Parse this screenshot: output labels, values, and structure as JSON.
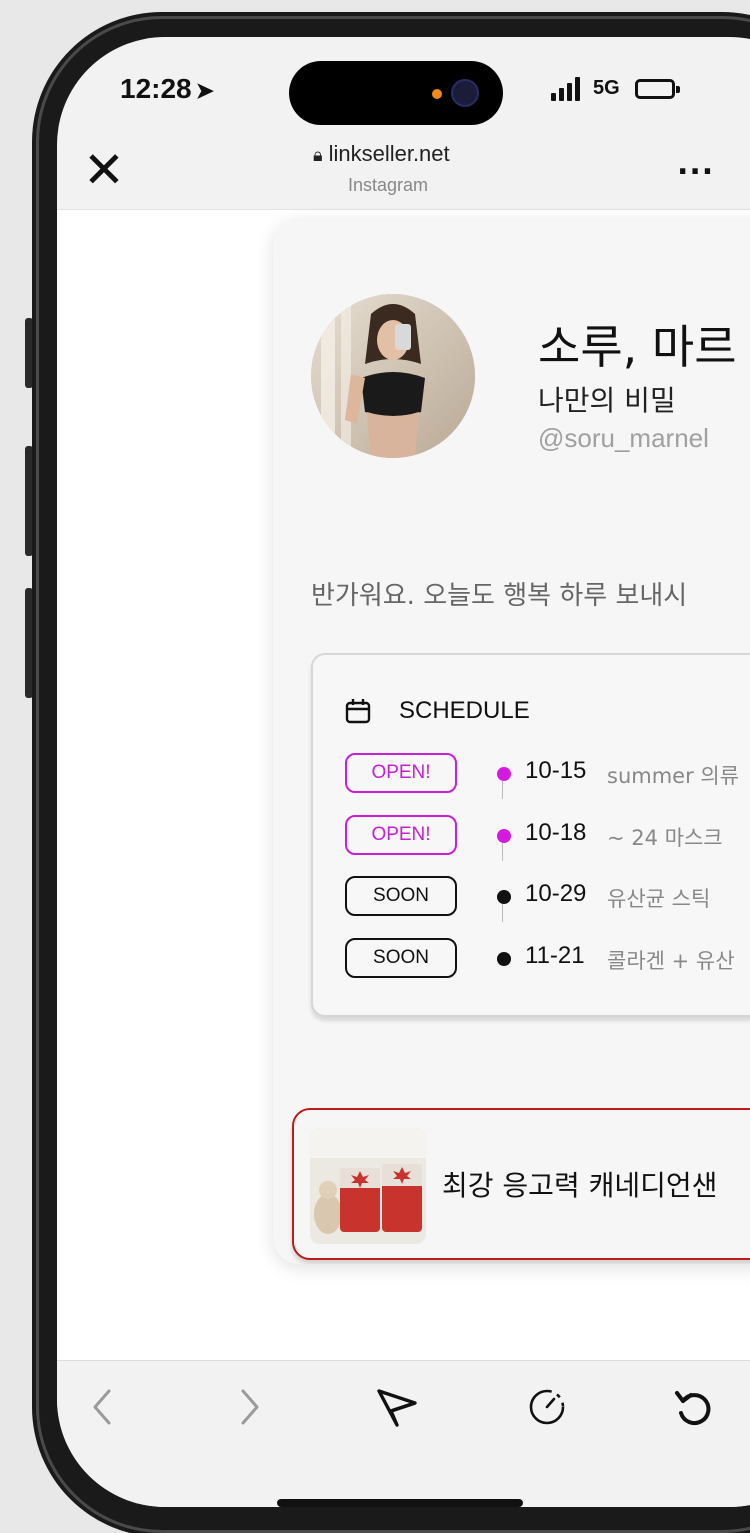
{
  "status_bar": {
    "time": "12:28",
    "network": "5G"
  },
  "browser": {
    "close_label": "✕",
    "url": "linkseller.net",
    "source": "Instagram",
    "more_label": "..."
  },
  "profile": {
    "name": "소루, 마르",
    "tagline": "나만의 비밀",
    "handle": "@soru_marnel",
    "greeting": "반가워요. 오늘도 행복 하루 보내시"
  },
  "schedule": {
    "title": "SCHEDULE",
    "items": [
      {
        "status": "OPEN!",
        "date": "10-15",
        "text": "summer 의류"
      },
      {
        "status": "OPEN!",
        "date": "10-18",
        "text": "~ 24 마스크"
      },
      {
        "status": "SOON",
        "date": "10-29",
        "text": "유산균 스틱"
      },
      {
        "status": "SOON",
        "date": "11-21",
        "text": "콜라겐 + 유산"
      }
    ]
  },
  "product": {
    "title": "최강 응고력 캐네디언샌"
  },
  "colors": {
    "open": "#c81ed6",
    "product_border": "#c01b1b"
  },
  "toolbar": {
    "icons": [
      "back-icon",
      "forward-icon",
      "share-icon",
      "compass-icon",
      "refresh-icon"
    ]
  }
}
